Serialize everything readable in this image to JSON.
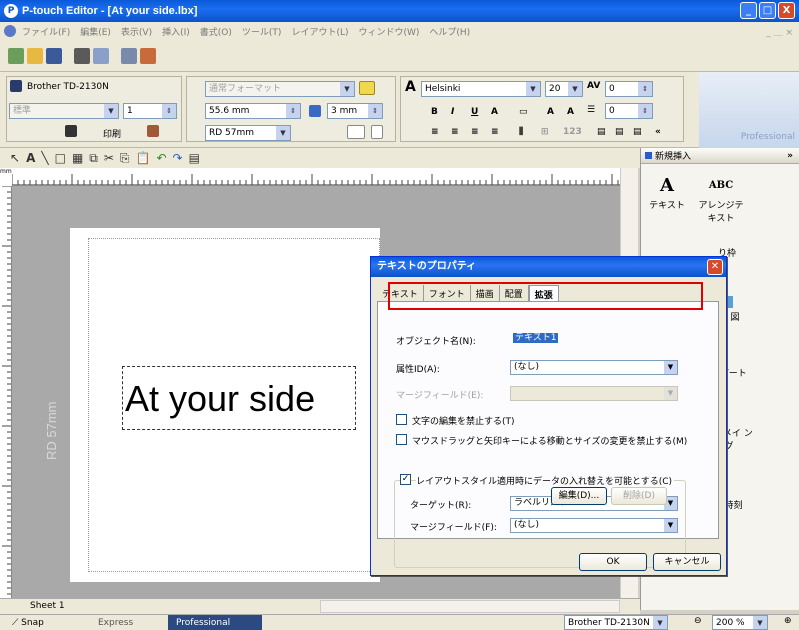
{
  "window": {
    "title": "P-touch Editor - [At your side.lbx]",
    "controls": [
      "_",
      "□",
      "X"
    ]
  },
  "menu": {
    "items": [
      "ファイル(F)",
      "編集(E)",
      "表示(V)",
      "挿入(I)",
      "書式(O)",
      "ツール(T)",
      "レイアウト(L)",
      "ウィンドウ(W)",
      "ヘルプ(H)"
    ],
    "mdi": "_ ＿ ×"
  },
  "propbar": {
    "printer": "Brother TD-2130N",
    "media": "標準",
    "copies": "1",
    "print_label": "印刷",
    "format": "通常フォーマット",
    "width": "55.6 mm",
    "margin": "3 mm",
    "tape": "RD 57mm",
    "font": "Helsinki",
    "size": "20",
    "spacing1": "0",
    "spacing2": "0",
    "more": "«",
    "professional": "Professional"
  },
  "sidebar": {
    "header": "新規挿入",
    "chevron": "»",
    "items": [
      {
        "label": "テキスト",
        "icon": "A"
      },
      {
        "label": "アレンジテキスト",
        "icon": "ABC"
      },
      {
        "label": "り枠",
        "icon": ""
      },
      {
        "label": "図",
        "icon": ""
      },
      {
        "label": "プアート",
        "icon": ""
      },
      {
        "label": "キーメイ ング",
        "icon": ""
      },
      {
        "label": "と時刻",
        "icon": ""
      }
    ]
  },
  "canvas": {
    "ruler_corner": "mm",
    "label_text": "At your side",
    "tape_label": "RD 57mm"
  },
  "sheetbar": {
    "sheet": "Sheet 1"
  },
  "statusbar": {
    "snap": "Snap",
    "express": "Express",
    "professional": "Professional",
    "printer": "Brother TD-2130N",
    "zoom": "200 %"
  },
  "dialog": {
    "title": "テキストのプロパティ",
    "tabs": [
      "テキスト",
      "フォント",
      "描画",
      "配置",
      "拡張"
    ],
    "active_tab": 4,
    "object_name_label": "オブジェクト名(N):",
    "object_name_value": "テキスト1",
    "attribute_id_label": "属性ID(A):",
    "attribute_id_value": "(なし)",
    "merge_field_label": "マージフィールド(E):",
    "merge_field_value": "",
    "lock_edit_label": "文字の編集を禁止する(T)",
    "lock_move_label": "マウスドラッグと矢印キーによる移動とサイズの変更を禁止する(M)",
    "layout_style_label": "レイアウトスタイル適用時にデータの入れ替えを可能とする(C)",
    "target_label": "ターゲット(R):",
    "target_value": "ラベルリスト",
    "merge_field2_label": "マージフィールド(F):",
    "merge_field2_value": "(なし)",
    "edit_button": "編集(D)...",
    "delete_button": "削除(D)",
    "ok_button": "OK",
    "cancel_button": "キャンセル"
  },
  "colors": {
    "xp_title": "#0b53c8",
    "highlight": "#e00000",
    "selection": "#316ac5"
  }
}
